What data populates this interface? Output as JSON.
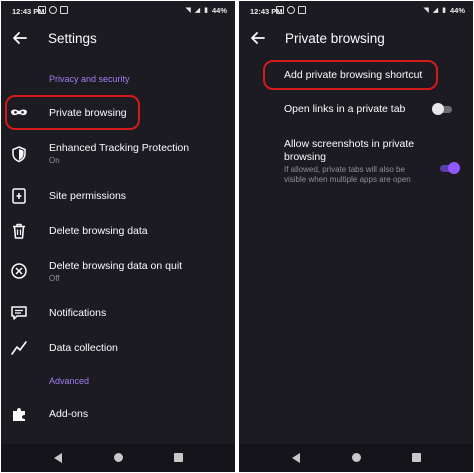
{
  "status_bar": {
    "time": "12:43 PM",
    "battery": "44%"
  },
  "settings_screen": {
    "title": "Settings",
    "section_privacy": "Privacy and security",
    "items": [
      {
        "label": "Private browsing",
        "icon": "mask-icon"
      },
      {
        "label": "Enhanced Tracking Protection",
        "sub": "On",
        "icon": "shield-icon"
      },
      {
        "label": "Site permissions",
        "icon": "site-permissions-icon"
      },
      {
        "label": "Delete browsing data",
        "icon": "trash-icon"
      },
      {
        "label": "Delete browsing data on quit",
        "sub": "Off",
        "icon": "circle-x-icon"
      },
      {
        "label": "Notifications",
        "icon": "message-icon"
      },
      {
        "label": "Data collection",
        "icon": "chart-line-icon"
      }
    ],
    "section_advanced": "Advanced",
    "advanced_items": [
      {
        "label": "Add-ons",
        "icon": "puzzle-icon"
      }
    ]
  },
  "private_screen": {
    "title": "Private browsing",
    "shortcut_label": "Add private browsing shortcut",
    "open_links_label": "Open links in a private tab",
    "open_links_enabled": false,
    "screenshots_label": "Allow screenshots in private browsing",
    "screenshots_desc": "If allowed, private tabs will also be visible when multiple apps are open",
    "screenshots_enabled": true
  },
  "colors": {
    "background": "#1c1b22",
    "accent": "#a07ef0",
    "highlight": "#d31b1b",
    "toggle_on": "#9059ff"
  }
}
